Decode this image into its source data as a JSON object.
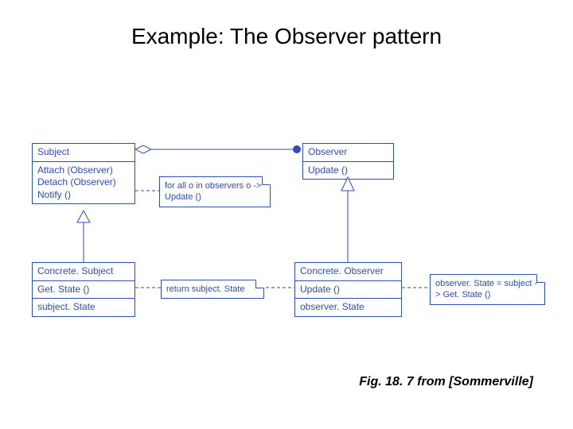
{
  "title": "Example: The Observer pattern",
  "caption": "Fig. 18. 7 from [Sommerville]",
  "classes": {
    "subject": {
      "name": "Subject",
      "ops": "Attach (Observer)\nDetach (Observer)\nNotify ()"
    },
    "observer": {
      "name": "Observer",
      "ops": "Update ()"
    },
    "concreteSubject": {
      "name": "Concrete. Subject",
      "ops": "Get. State ()",
      "attrs": "subject. State"
    },
    "concreteObserver": {
      "name": "Concrete. Observer",
      "ops": "Update ()",
      "attrs": "observer. State"
    }
  },
  "notes": {
    "notify": "for all o in observers\n     o -> Update ()",
    "getstate": "return subject. State",
    "update": "observer. State =\nsubject -> Get. State ()"
  }
}
